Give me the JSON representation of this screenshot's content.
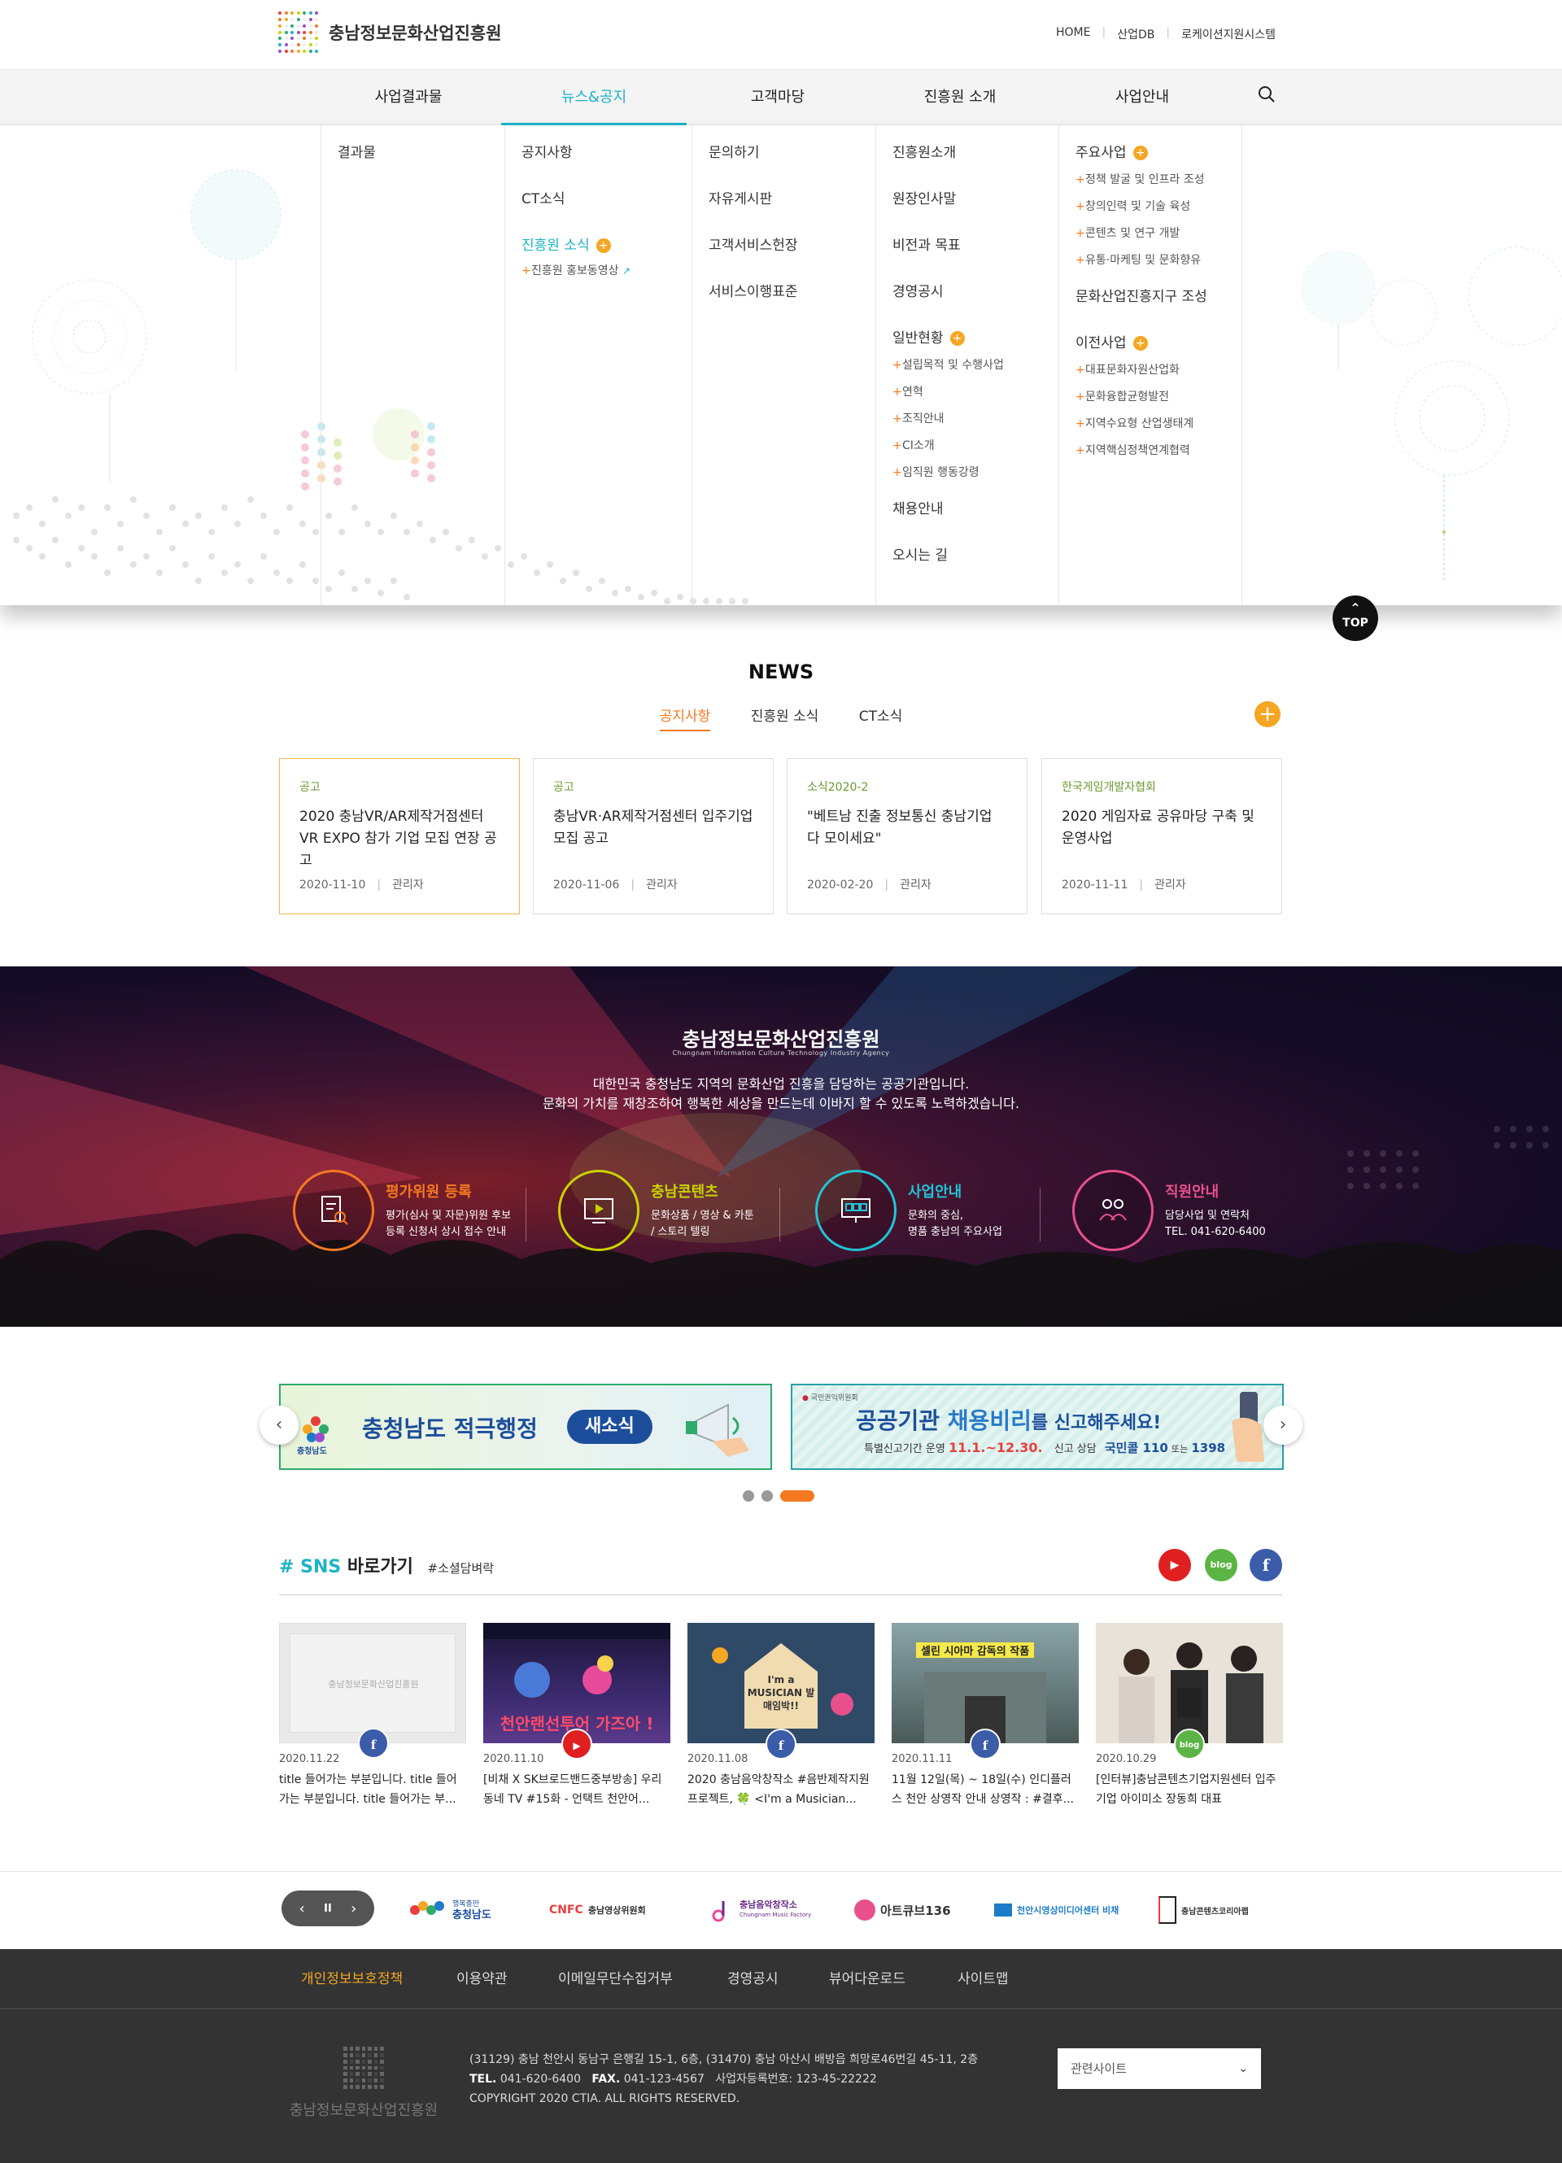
{
  "site": {
    "name": "충남정보문화산업진흥원"
  },
  "util": {
    "home": "HOME",
    "db": "산업DB",
    "system": "로케이션지원시스템"
  },
  "gnb": [
    {
      "label": "사업결과물"
    },
    {
      "label": "뉴스&공지"
    },
    {
      "label": "고객마당"
    },
    {
      "label": "진흥원 소개"
    },
    {
      "label": "사업안내"
    }
  ],
  "mega": {
    "col1": {
      "items": [
        "결과물"
      ]
    },
    "col2": {
      "items": [
        "공지사항",
        "CT소식",
        "진흥원 소식"
      ],
      "subs": [
        "진흥원 홍보동영상"
      ]
    },
    "col3": {
      "items": [
        "문의하기",
        "자유게시판",
        "고객서비스헌장",
        "서비스이행표준"
      ]
    },
    "col4": {
      "items": [
        "진흥원소개",
        "원장인사말",
        "비전과 목표",
        "경영공시",
        "일반현황",
        "채용안내",
        "오시는 길"
      ],
      "subs": [
        "설립목적 및 수행사업",
        "연혁",
        "조직안내",
        "CI소개",
        "임직원 행동강령"
      ]
    },
    "col5": {
      "head1": "주요사업",
      "subs1": [
        "정책 발굴 및 인프라 조성",
        "창의인력 및 기술 육성",
        "콘텐츠 및 연구 개발",
        "유통·마케팅 및 문화향유"
      ],
      "head2": "문화산업진흥지구 조성",
      "head3": "이전사업",
      "subs3": [
        "대표문화자원산업화",
        "문화융합균형발전",
        "지역수요형 산업생태계",
        "지역핵심정책연계협력"
      ]
    }
  },
  "top_label": "TOP",
  "news": {
    "title": "NEWS",
    "tabs": [
      "공지사항",
      "진흥원 소식",
      "CT소식"
    ],
    "more": "+",
    "cards": [
      {
        "cat": "공고",
        "title": "2020 충남VR/AR제작거점센터 VR EXPO 참가 기업 모집 연장 공고",
        "date": "2020-11-10",
        "author": "관리자"
      },
      {
        "cat": "공고",
        "title": "충남VR·AR제작거점센터 입주기업 모집 공고",
        "date": "2020-11-06",
        "author": "관리자"
      },
      {
        "cat": "소식2020-2",
        "title": "\"베트남 진출 정보통신 충남기업 다 모이세요\"",
        "date": "2020-02-20",
        "author": "관리자"
      },
      {
        "cat": "한국게임개발자협회",
        "title": "2020 게임자료 공유마당 구축 및 운영사업",
        "date": "2020-11-11",
        "author": "관리자"
      }
    ]
  },
  "hero": {
    "title": "충남정보문화산업진흥원",
    "sub": "Chungnam Information Culture Technology Industry Agency",
    "desc1": "대한민국 충청남도 지역의 문화산업 진흥을 담당하는 공공기관입니다.",
    "desc2": "문화의 가치를 재창조하여 행복한 세상을 만드는데 이바지 할 수 있도록 노력하겠습니다.",
    "services": [
      {
        "title": "평가위원 등록",
        "desc1": "평가(심사 및 자문)위원 후보",
        "desc2": "등록 신청서 상시 접수 안내",
        "color": "#f47920"
      },
      {
        "title": "충남콘텐츠",
        "desc1": "문화상품 / 영상 & 카툰",
        "desc2": "/ 스토리 텔링",
        "color": "#c8d400"
      },
      {
        "title": "사업안내",
        "desc1": "문화의 중심,",
        "desc2": "명품 충남의 주요사업",
        "color": "#22c3d6"
      },
      {
        "title": "직원안내",
        "desc1": "담당사업 및 연락처",
        "desc2": "TEL. 041-620-6400",
        "color": "#e8508c"
      }
    ]
  },
  "banners": {
    "b1": {
      "region": "충청남도",
      "main": "충청남도 적극행정",
      "pill": "새소식"
    },
    "b2": {
      "org": "국민권익위원회",
      "main1": "공공기관",
      "main2": "채용비리",
      "main3": "를 신고",
      "main4": "해주세요!",
      "line1": "특별신고기간 운영",
      "period": "11.1.~12.30.",
      "line2": "신고 상담",
      "call": "국민콜 110",
      "or": "또는",
      "num": "1398"
    }
  },
  "sns": {
    "hash": "# SNS",
    "title": "바로가기",
    "tag": "#소셜담벼락",
    "icons": [
      "youtube-icon",
      "blog-icon",
      "facebook-icon"
    ],
    "blog_label": "blog",
    "youtube_label": "▶",
    "facebook_label": "f",
    "posts": [
      {
        "date": "2020.11.22",
        "text": "title 들어가는 부분입니다. title 들어가는 부분입니다. title 들어가는 부...",
        "type": "facebook",
        "thumb_text": "충남정보문화산업진흥원"
      },
      {
        "date": "2020.11.10",
        "text": "[비채 X SK브로드밴드중부방송] 우리동네 TV #15화 - 언택트 천안어...",
        "type": "youtube",
        "thumb_text": "천안랜선투어 가즈아 !"
      },
      {
        "date": "2020.11.08",
        "text": "2020 충남음악창작소 #음반제작지원 프로젝트, 🍀 <I'm a Musician...",
        "type": "facebook",
        "thumb_text": "I'm a MUSICIAN 발매임박!!"
      },
      {
        "date": "2020.11.11",
        "text": "11월 12일(목) ~ 18일(수) 인디플러스 천안 상영작 안내 상영작 : #결후...",
        "type": "facebook",
        "thumb_text": "셀린 시아마 감독의 작품"
      },
      {
        "date": "2020.10.29",
        "text": "[인터뷰]충남콘텐츠기업지원센터 입주기업 아이미소 장동희 대표",
        "type": "blog",
        "thumb_text": ""
      }
    ]
  },
  "partners": [
    {
      "name": "충청남도",
      "sub": "행복충만"
    },
    {
      "name": "충남영상위원회",
      "sub": "CNFC"
    },
    {
      "name": "충남음악창작소",
      "sub": "Chungnam Music Factory"
    },
    {
      "name": "아트큐브136",
      "sub": ""
    },
    {
      "name": "천안시영상미디어센터 비채",
      "sub": ""
    },
    {
      "name": "충남콘텐츠코리아랩",
      "sub": ""
    }
  ],
  "partner_ctrl": {
    "prev": "‹",
    "pause": "II",
    "next": "›"
  },
  "footer_nav": [
    "개인정보보호정책",
    "이용약관",
    "이메일무단수집거부",
    "경영공시",
    "뷰어다운로드",
    "사이트맵"
  ],
  "footer": {
    "address": "(31129) 충남 천안시 동남구 은행길 15-1, 6층, (31470) 충남 아산시 배방읍 희망로46번길 45-11, 2층",
    "tel_label": "TEL.",
    "tel": "041-620-6400",
    "fax_label": "FAX.",
    "fax": "041-123-4567",
    "biz": "사업자등록번호: 123-45-22222",
    "copyright": "COPYRIGHT 2020 CTIA. ALL RIGHTS RESERVED.",
    "related": "관련사이트"
  },
  "colors": {
    "accent": "#1cb3c8",
    "orange": "#f47920",
    "yellow": "#f5a623",
    "green": "#6a9a2f"
  }
}
